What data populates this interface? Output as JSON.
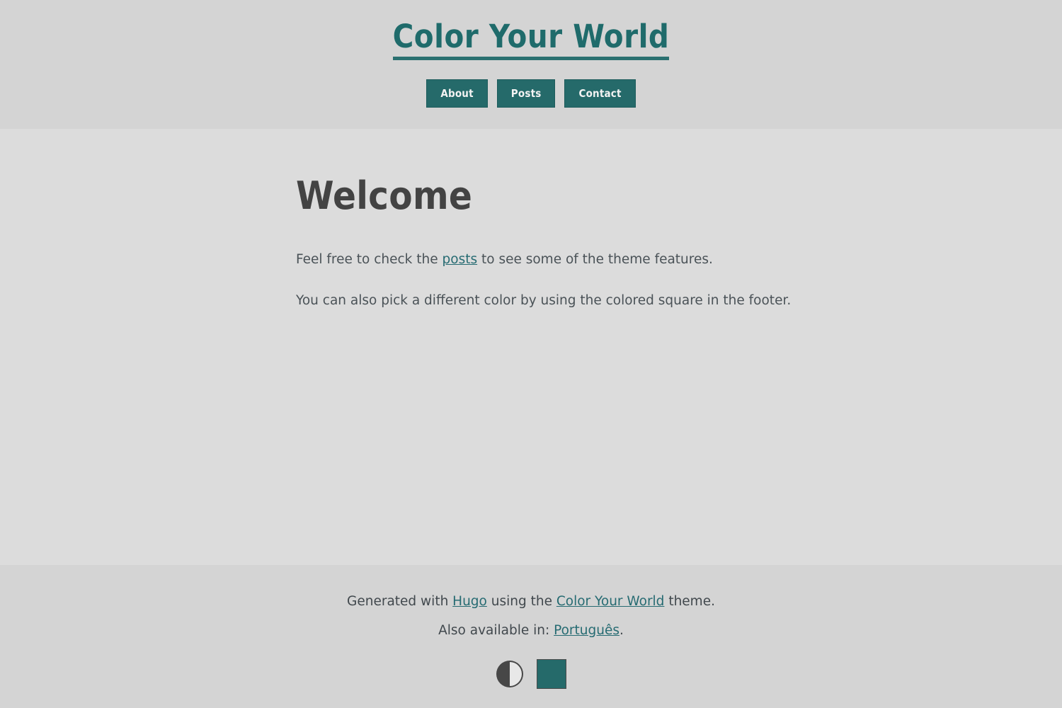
{
  "header": {
    "site_title": "Color Your World",
    "nav": [
      {
        "label": "About"
      },
      {
        "label": "Posts"
      },
      {
        "label": "Contact"
      }
    ]
  },
  "main": {
    "heading": "Welcome",
    "paragraph1": {
      "before": "Feel free to check the ",
      "link": "posts",
      "after": " to see some of the theme features."
    },
    "paragraph2": "You can also pick a different color by using the colored square in the footer."
  },
  "footer": {
    "line1": {
      "before": "Generated with ",
      "link1": "Hugo",
      "middle": " using the ",
      "link2": "Color Your World",
      "after": " theme."
    },
    "line2": {
      "before": "Also available in: ",
      "link": "Português",
      "after": "."
    },
    "contrast_icon": "contrast-half-circle-icon",
    "swatch_color": "#256a6a"
  },
  "colors": {
    "accent": "#256a6a",
    "link": "#266b72",
    "header_bg": "#d4d4d4",
    "main_bg": "#dcdcdc",
    "heading_text": "#434343",
    "body_text": "#4a5257"
  }
}
